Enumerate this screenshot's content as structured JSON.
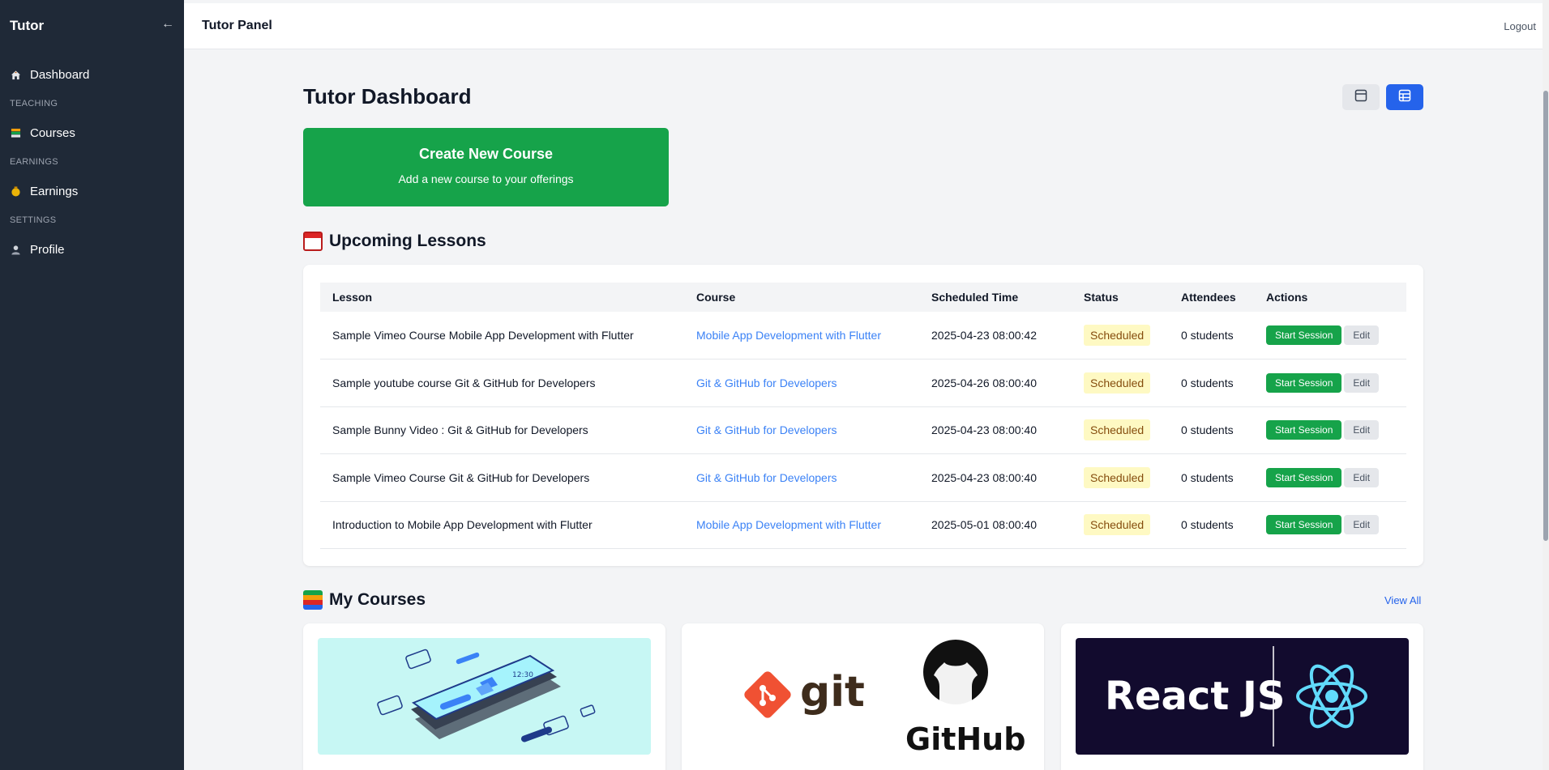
{
  "sidebar": {
    "brand": "Tutor",
    "collapse_icon": "←",
    "dashboard": "Dashboard",
    "section_teaching": "TEACHING",
    "courses": "Courses",
    "section_earnings": "EARNINGS",
    "earnings": "Earnings",
    "section_settings": "SETTINGS",
    "profile": "Profile"
  },
  "topbar": {
    "title": "Tutor Panel",
    "logout": "Logout"
  },
  "main": {
    "title": "Tutor Dashboard",
    "create_card": {
      "title": "Create New Course",
      "subtitle": "Add a new course to your offerings"
    }
  },
  "upcoming": {
    "heading": "Upcoming Lessons",
    "columns": [
      "Lesson",
      "Course",
      "Scheduled Time",
      "Status",
      "Attendees",
      "Actions"
    ],
    "rows": [
      {
        "lesson": "Sample Vimeo Course Mobile App Development with Flutter",
        "course": "Mobile App Development with Flutter",
        "time": "2025-04-23 08:00:42",
        "status": "Scheduled",
        "attendees": "0 students",
        "start": "Start Session",
        "edit": "Edit"
      },
      {
        "lesson": "Sample youtube course Git & GitHub for Developers",
        "course": "Git & GitHub for Developers",
        "time": "2025-04-26 08:00:40",
        "status": "Scheduled",
        "attendees": "0 students",
        "start": "Start Session",
        "edit": "Edit"
      },
      {
        "lesson": "Sample Bunny Video : Git & GitHub for Developers",
        "course": "Git & GitHub for Developers",
        "time": "2025-04-23 08:00:40",
        "status": "Scheduled",
        "attendees": "0 students",
        "start": "Start Session",
        "edit": "Edit"
      },
      {
        "lesson": "Sample Vimeo Course Git & GitHub for Developers",
        "course": "Git & GitHub for Developers",
        "time": "2025-04-23 08:00:40",
        "status": "Scheduled",
        "attendees": "0 students",
        "start": "Start Session",
        "edit": "Edit"
      },
      {
        "lesson": "Introduction to Mobile App Development with Flutter",
        "course": "Mobile App Development with Flutter",
        "time": "2025-05-01 08:00:40",
        "status": "Scheduled",
        "attendees": "0 students",
        "start": "Start Session",
        "edit": "Edit"
      }
    ]
  },
  "my_courses": {
    "heading": "My Courses",
    "view_all": "View All",
    "thumbs": {
      "flutter_clock": "12:30",
      "git_word": "git",
      "github_word": "GitHub",
      "react_word": "React JS"
    }
  },
  "colors": {
    "sidebar": "#1f2937",
    "primary": "#2563eb",
    "success": "#16a34a",
    "link": "#3b82f6",
    "badge_bg": "#fef9c3"
  },
  "icons": [
    "home-icon",
    "courses-icon",
    "money-bag-icon",
    "user-icon",
    "list-view-icon",
    "grid-view-icon",
    "calendar-icon",
    "books-icon",
    "arrow-left-icon"
  ]
}
